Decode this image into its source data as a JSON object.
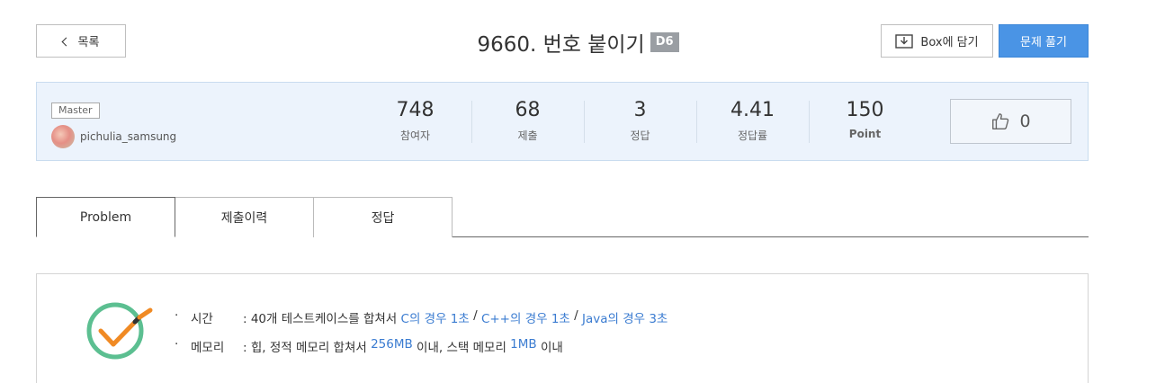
{
  "header": {
    "back_label": "목록",
    "title": "9660. 번호 붙이기",
    "level": "D6",
    "box_label": "Box에 담기",
    "solve_label": "문제 풀기"
  },
  "stats": {
    "tier": "Master",
    "author": "pichulia_samsung",
    "items": [
      {
        "value": "748",
        "label": "참여자"
      },
      {
        "value": "68",
        "label": "제출"
      },
      {
        "value": "3",
        "label": "정답"
      },
      {
        "value": "4.41",
        "label": "정답률"
      },
      {
        "value": "150",
        "label": "Point"
      }
    ],
    "likes": "0"
  },
  "tabs": [
    {
      "label": "Problem"
    },
    {
      "label": "제출이력"
    },
    {
      "label": "정답"
    }
  ],
  "limits": {
    "bullet": "·",
    "time_label": "시간",
    "time_prefix": ": 40개 테스트케이스를 합쳐서 ",
    "time_c": "C의 경우 1초",
    "sep1": " / ",
    "time_cpp": "C++의 경우 1초",
    "sep2": " / ",
    "time_java": "Java의 경우 3초",
    "mem_label": "메모리",
    "mem_prefix": ": 힙, 정적 메모리 합쳐서 ",
    "mem_heap": "256MB",
    "mem_mid": " 이내, 스택 메모리 ",
    "mem_stack": "1MB",
    "mem_suffix": " 이내"
  },
  "colors": {
    "accent": "#4a94e5",
    "link": "#3b7cd1",
    "panel_bg": "#ecf3fc",
    "check_green": "#5cbf91",
    "check_orange": "#f08a24"
  }
}
